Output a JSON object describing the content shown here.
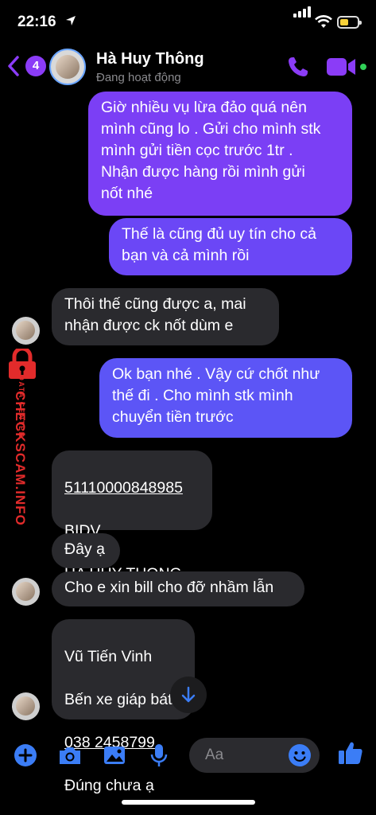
{
  "status_bar": {
    "time": "22:16",
    "battery_level": 0.5
  },
  "header": {
    "back_badge": "4",
    "contact_name": "Hà Huy Thông",
    "contact_status": "Đang hoạt động",
    "accent_color": "#8b3cf7"
  },
  "messages": [
    {
      "from": "me",
      "text": "Giờ nhiều vụ lừa đảo quá nên\nmình cũng lo . Gửi cho mình stk\nmình gửi tiền cọc trước 1tr .\nNhận được hàng rồi mình gửi\nnốt nhé"
    },
    {
      "from": "me",
      "text": "Thế là cũng đủ uy tín cho cả\nbạn và cả mình rồi"
    },
    {
      "from": "them",
      "text": "Thôi thế cũng được a, mai\nnhận được ck nốt dùm e"
    },
    {
      "from": "me",
      "text": "Ok bạn nhé . Vậy cứ chốt như\nthế đi . Cho mình stk mình\nchuyển tiền trước"
    },
    {
      "from": "them",
      "account_number": "51110000848985",
      "bank": "BIDV",
      "account_name": "HA HUY THONG"
    },
    {
      "from": "them",
      "text": "Đây ạ"
    },
    {
      "from": "them",
      "text": "Cho e xin bill cho đỡ nhầm lẫn"
    },
    {
      "from": "them",
      "line1": "Vũ Tiến Vinh",
      "line2": "Bến xe giáp bát",
      "phone": "038 2458799",
      "line4": "Đúng chưa ạ"
    }
  ],
  "watermark": {
    "main": "CHECKSCAM.INFO",
    "sub": "DATA CENTER"
  },
  "composer": {
    "placeholder": "Aa"
  },
  "icons": [
    "location-arrow-icon",
    "signal-icon",
    "wifi-icon",
    "battery-icon",
    "back-chevron-icon",
    "phone-icon",
    "video-camera-icon",
    "lock-icon",
    "arrow-down-icon",
    "plus-icon",
    "camera-icon",
    "image-icon",
    "microphone-icon",
    "emoji-icon",
    "thumbs-up-icon"
  ]
}
